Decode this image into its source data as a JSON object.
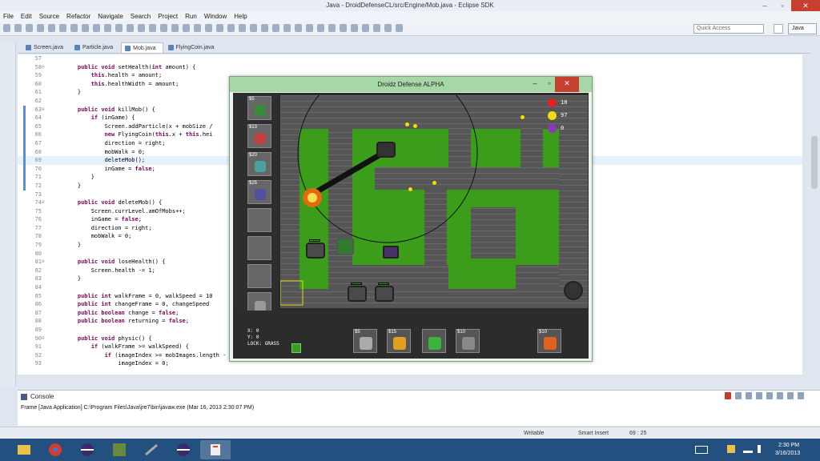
{
  "window": {
    "title": "Java - DroidDefenseCL/src/Engine/Mob.java - Eclipse SDK"
  },
  "menu": [
    "File",
    "Edit",
    "Source",
    "Refactor",
    "Navigate",
    "Search",
    "Project",
    "Run",
    "Window",
    "Help"
  ],
  "toolbar": {
    "quick_access_placeholder": "Quick Access",
    "perspective_label": "Java"
  },
  "tabs": [
    {
      "label": "Screen.java",
      "active": false
    },
    {
      "label": "Particle.java",
      "active": false
    },
    {
      "label": "Mob.java",
      "active": true
    },
    {
      "label": "FlyingCoin.java",
      "active": false
    }
  ],
  "code": [
    {
      "n": "57",
      "t": ""
    },
    {
      "n": "58",
      "t": "    public void setHealth(int amount) {",
      "fold": true
    },
    {
      "n": "59",
      "t": "        this.health = amount;"
    },
    {
      "n": "60",
      "t": "        this.healthWidth = amount;"
    },
    {
      "n": "61",
      "t": "    }"
    },
    {
      "n": "62",
      "t": ""
    },
    {
      "n": "63",
      "t": "    public void killMob() {",
      "fold": true,
      "mark": true
    },
    {
      "n": "64",
      "t": "        if (inGame) {",
      "mark": true
    },
    {
      "n": "65",
      "t": "            Screen.addParticle(x + mobSize /",
      "mark": true
    },
    {
      "n": "66",
      "t": "            new FlyingCoin(this.x + this.hei",
      "mark": true
    },
    {
      "n": "67",
      "t": "            direction = right;",
      "mark": true
    },
    {
      "n": "68",
      "t": "            mobWalk = 0;",
      "mark": true
    },
    {
      "n": "69",
      "t": "            deleteMob();",
      "mark": true,
      "hl": true
    },
    {
      "n": "70",
      "t": "            inGame = false;",
      "mark": true
    },
    {
      "n": "71",
      "t": "        }",
      "mark": true
    },
    {
      "n": "72",
      "t": "    }",
      "mark": true
    },
    {
      "n": "73",
      "t": ""
    },
    {
      "n": "74",
      "t": "    public void deleteMob() {",
      "fold": true
    },
    {
      "n": "75",
      "t": "        Screen.currLevel.amOfMobs++;"
    },
    {
      "n": "76",
      "t": "        inGame = false;"
    },
    {
      "n": "77",
      "t": "        direction = right;"
    },
    {
      "n": "78",
      "t": "        mobWalk = 0;"
    },
    {
      "n": "79",
      "t": "    }"
    },
    {
      "n": "80",
      "t": ""
    },
    {
      "n": "81",
      "t": "    public void loseHealth() {",
      "fold": true
    },
    {
      "n": "82",
      "t": "        Screen.health -= 1;"
    },
    {
      "n": "83",
      "t": "    }"
    },
    {
      "n": "84",
      "t": ""
    },
    {
      "n": "85",
      "t": "    public int walkFrame = 0, walkSpeed = 10"
    },
    {
      "n": "86",
      "t": "    public int changeFrame = 0, changeSpeed"
    },
    {
      "n": "87",
      "t": "    public boolean change = false;"
    },
    {
      "n": "88",
      "t": "    public boolean returning = false;"
    },
    {
      "n": "89",
      "t": ""
    },
    {
      "n": "90",
      "t": "    public void physic() {",
      "fold": true
    },
    {
      "n": "91",
      "t": "        if (walkFrame >= walkSpeed) {"
    },
    {
      "n": "92",
      "t": "            if (imageIndex >= mobImages.length - 1) {"
    },
    {
      "n": "93",
      "t": "                imageIndex = 0;"
    }
  ],
  "console": {
    "tab_label": "Console",
    "line": "Frame [Java Application] C:\\Program Files\\Java\\jre7\\bin\\javaw.exe (Mar 16, 2013 2:30:07 PM)"
  },
  "status": {
    "writable": "Writable",
    "insert_mode": "Smart Insert",
    "position": "69 : 25"
  },
  "game": {
    "title": "Droidz Defense ALPHA",
    "stats": {
      "health": "10",
      "coins": "97",
      "gems": "0"
    },
    "shop_slots": [
      {
        "price": "$5",
        "color": "#3a8a3a"
      },
      {
        "price": "$13",
        "color": "#c04040"
      },
      {
        "price": "$20",
        "color": "#4aa0a0"
      },
      {
        "price": "$25",
        "color": "#5050a0"
      },
      {
        "price": "",
        "color": ""
      },
      {
        "price": "",
        "color": ""
      },
      {
        "price": "",
        "color": ""
      },
      {
        "price": "",
        "color": "#999999"
      }
    ],
    "bottom_slots": [
      {
        "price": "$5",
        "color": "#aaaaaa"
      },
      {
        "price": "$15",
        "color": "#e0a020"
      },
      {
        "price": "",
        "color": "#3cb43c"
      },
      {
        "price": "$10",
        "color": "#888888"
      },
      {
        "price": "$10",
        "color": "#e06020"
      }
    ],
    "coords": {
      "x": "X: 0",
      "y": "Y: 0",
      "lock": "LOCK:",
      "grass": "GRASS"
    }
  },
  "taskbar": {
    "time": "2:30 PM",
    "date": "3/16/2013"
  }
}
